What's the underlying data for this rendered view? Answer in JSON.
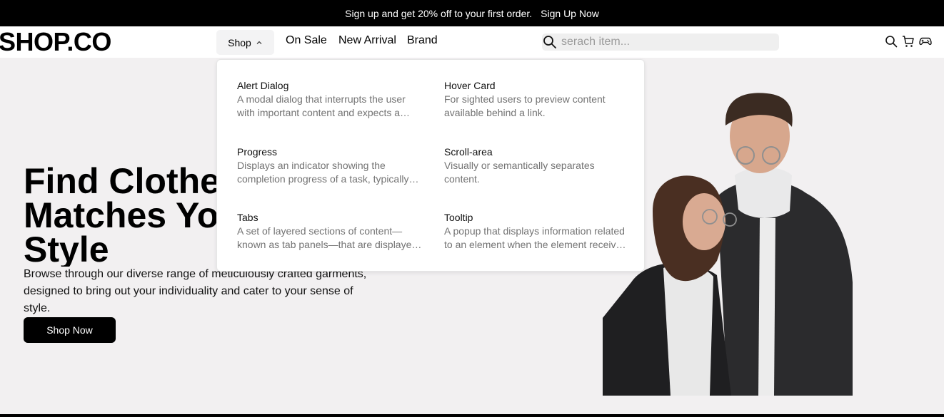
{
  "promo": {
    "text": "Sign up and get 20% off to your first order.",
    "link": "Sign Up Now"
  },
  "header": {
    "logo": "SHOP.CO",
    "shop_label": "Shop",
    "links": [
      "On Sale",
      "New Arrival",
      "Brand"
    ],
    "search_placeholder": "serach item...",
    "icons": [
      "search-icon",
      "cart-icon",
      "gamepad-icon"
    ]
  },
  "dropdown": {
    "items": [
      {
        "title": "Alert Dialog",
        "description": "A modal dialog that interrupts the user with important content and expects a response."
      },
      {
        "title": "Hover Card",
        "description": "For sighted users to preview content available behind a link."
      },
      {
        "title": "Progress",
        "description": "Displays an indicator showing the completion progress of a task, typically displayed as a progress bar."
      },
      {
        "title": "Scroll-area",
        "description": "Visually or semantically separates content."
      },
      {
        "title": "Tabs",
        "description": "A set of layered sections of content—known as tab panels—that are displayed one at a time."
      },
      {
        "title": "Tooltip",
        "description": "A popup that displays information related to an element when the element receives keyboard focus or the mouse hovers over it."
      }
    ]
  },
  "hero": {
    "title_lines": [
      "Find Clothes That",
      "Matches Your",
      "Style"
    ],
    "description": "Browse through our diverse range of meticulously crafted garments, designed to bring out your individuality and cater to your sense of style.",
    "cta": "Shop Now"
  },
  "colors": {
    "promo_bg": "#000000",
    "hero_bg": "#f2f0f1",
    "button_bg": "#000000",
    "muted_text": "#737373"
  }
}
